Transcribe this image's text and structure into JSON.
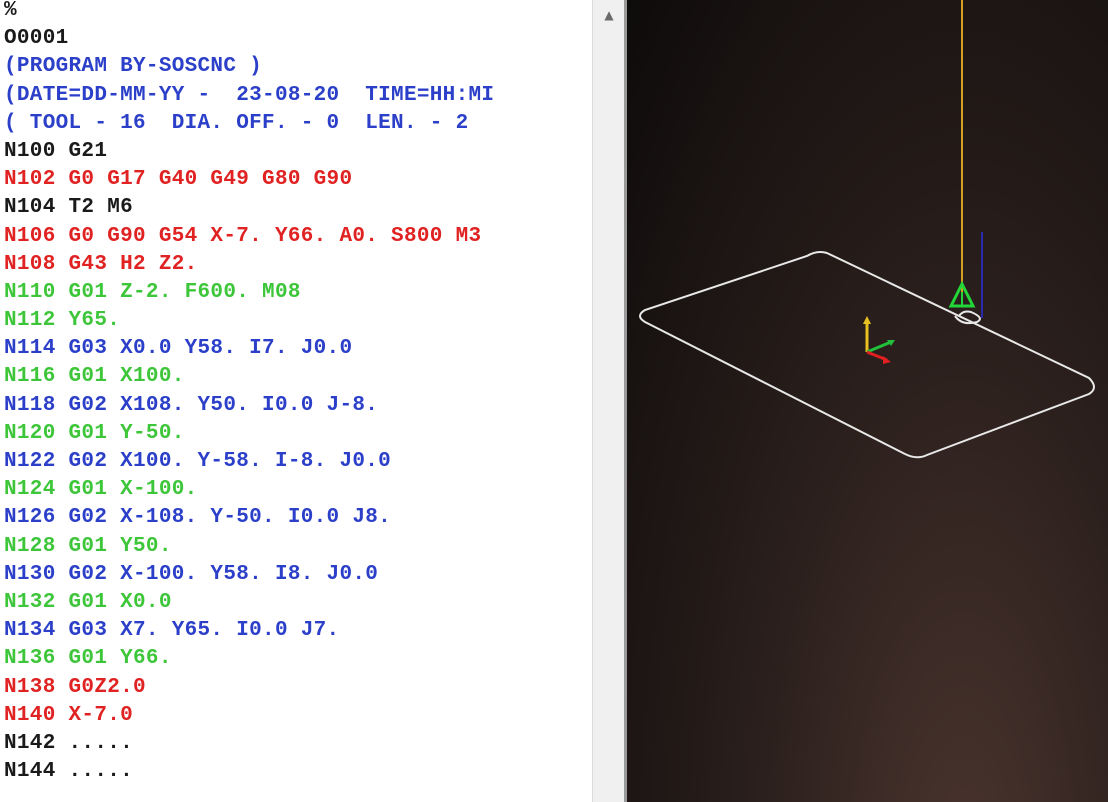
{
  "editor": {
    "lines": [
      {
        "text": "%",
        "color": "#1a1a1a"
      },
      {
        "text": "O0001",
        "color": "#1a1a1a"
      },
      {
        "text": "(PROGRAM BY-SOSCNC )",
        "color": "#2b3fc9"
      },
      {
        "text": "(DATE=DD-MM-YY -  23-08-20  TIME=HH:MI",
        "color": "#2b3fc9"
      },
      {
        "text": "( TOOL - 16  DIA. OFF. - 0  LEN. - 2",
        "color": "#2b3fc9"
      },
      {
        "text": "N100 G21",
        "color": "#1a1a1a"
      },
      {
        "text": "N102 G0 G17 G40 G49 G80 G90",
        "color": "#e02222"
      },
      {
        "text": "N104 T2 M6",
        "color": "#1a1a1a"
      },
      {
        "text": "N106 G0 G90 G54 X-7. Y66. A0. S800 M3",
        "color": "#e02222"
      },
      {
        "text": "N108 G43 H2 Z2.",
        "color": "#e02222"
      },
      {
        "text": "N110 G01 Z-2. F600. M08",
        "color": "#3ec63a"
      },
      {
        "text": "N112 Y65.",
        "color": "#3ec63a"
      },
      {
        "text": "N114 G03 X0.0 Y58. I7. J0.0",
        "color": "#2b3fc9"
      },
      {
        "text": "N116 G01 X100.",
        "color": "#3ec63a"
      },
      {
        "text": "N118 G02 X108. Y50. I0.0 J-8.",
        "color": "#2b3fc9"
      },
      {
        "text": "N120 G01 Y-50.",
        "color": "#3ec63a"
      },
      {
        "text": "N122 G02 X100. Y-58. I-8. J0.0",
        "color": "#2b3fc9"
      },
      {
        "text": "N124 G01 X-100.",
        "color": "#3ec63a"
      },
      {
        "text": "N126 G02 X-108. Y-50. I0.0 J8.",
        "color": "#2b3fc9"
      },
      {
        "text": "N128 G01 Y50.",
        "color": "#3ec63a"
      },
      {
        "text": "N130 G02 X-100. Y58. I8. J0.0",
        "color": "#2b3fc9"
      },
      {
        "text": "N132 G01 X0.0",
        "color": "#3ec63a"
      },
      {
        "text": "N134 G03 X7. Y65. I0.0 J7.",
        "color": "#2b3fc9"
      },
      {
        "text": "N136 G01 Y66.",
        "color": "#3ec63a"
      },
      {
        "text": "N138 G0Z2.0",
        "color": "#e02222"
      },
      {
        "text": "N140 X-7.0",
        "color": "#e02222"
      },
      {
        "text": "N142 .....",
        "color": "#1a1a1a"
      },
      {
        "text": "N144 .....",
        "color": "#1a1a1a"
      }
    ]
  },
  "scrollbar": {
    "up_arrow": "▲"
  },
  "viewport": {
    "background_color": "#1a1412",
    "toolpath_color": "#e8e8e8",
    "tool_line_color": "#d4a020",
    "tool_marker_color": "#22d63a",
    "axis_colors": {
      "x": "#e02020",
      "y": "#22c03a",
      "z": "#e8c020"
    },
    "icons": [
      "toolpath-outline",
      "tool-position-marker",
      "origin-axis-triad-icon"
    ]
  }
}
